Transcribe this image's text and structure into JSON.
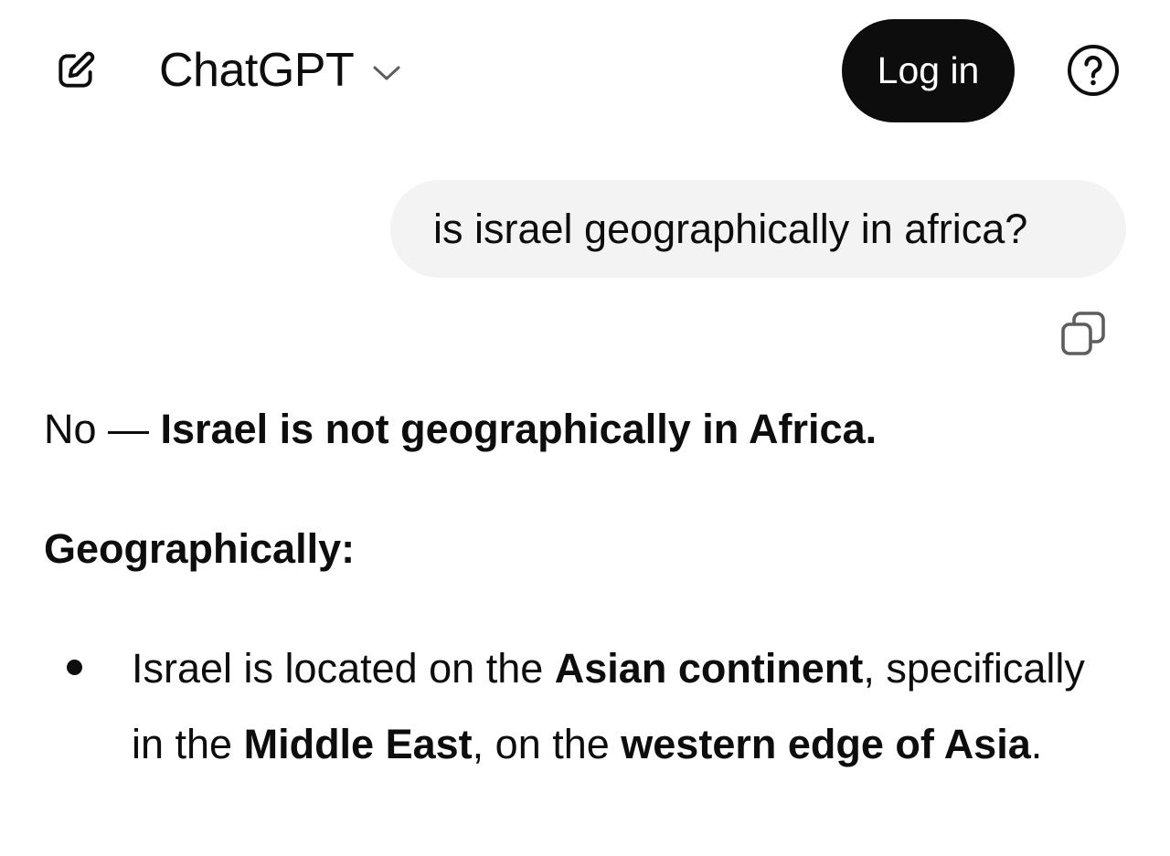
{
  "header": {
    "new_chat_icon": "edit-square-icon",
    "model_name": "ChatGPT",
    "model_chevron_icon": "chevron-down-icon",
    "login_label": "Log in",
    "help_icon": "question-circle-icon"
  },
  "conversation": {
    "user_message": "is israel geographically in africa?",
    "copy_icon": "copy-icon",
    "assistant": {
      "answer_prefix": "No — ",
      "answer_bold": "Israel is not geographically in Africa.",
      "section_heading": "Geographically:",
      "bullets": [
        {
          "t1": "Israel is located on the ",
          "b1": "Asian continent",
          "t2": ", specifically in the ",
          "b2": "Middle East",
          "t3": ", on the ",
          "b3": "western edge of Asia",
          "t4": "."
        }
      ]
    }
  },
  "colors": {
    "text": "#0d0d0d",
    "login_bg": "#0d0d0d",
    "login_text": "#ffffff",
    "user_bubble_bg": "#f3f3f3",
    "icon_gray": "#5d5d5d"
  }
}
